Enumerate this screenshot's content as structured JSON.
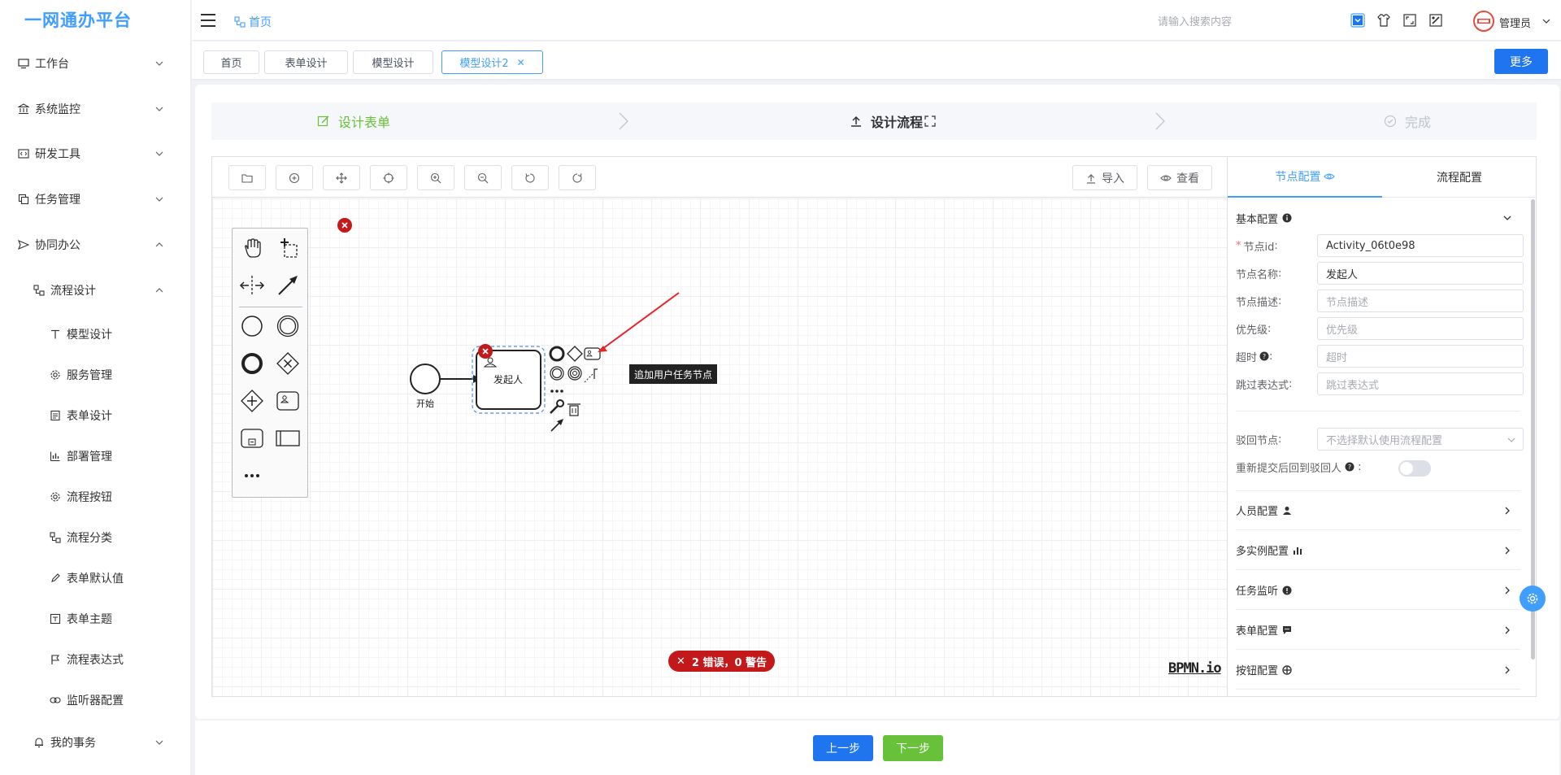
{
  "app": {
    "title": "一网通办平台"
  },
  "header": {
    "breadcrumb": "首页",
    "search_placeholder": "请输入搜索内容",
    "user": "管理员"
  },
  "sidebar": {
    "items": [
      {
        "label": "工作台",
        "level": 1,
        "expanded": false,
        "icon": "monitor-icon"
      },
      {
        "label": "系统监控",
        "level": 1,
        "expanded": false,
        "icon": "bank-icon"
      },
      {
        "label": "研发工具",
        "level": 1,
        "expanded": false,
        "icon": "code-window-icon"
      },
      {
        "label": "任务管理",
        "level": 1,
        "expanded": false,
        "icon": "copy-icon"
      },
      {
        "label": "协同办公",
        "level": 1,
        "expanded": true,
        "icon": "send-icon"
      },
      {
        "label": "流程设计",
        "level": 2,
        "expanded": true,
        "icon": "flow-icon"
      },
      {
        "label": "模型设计",
        "level": 3,
        "icon": "text-t-icon"
      },
      {
        "label": "服务管理",
        "level": 3,
        "icon": "gear-icon"
      },
      {
        "label": "表单设计",
        "level": 3,
        "icon": "form-icon"
      },
      {
        "label": "部署管理",
        "level": 3,
        "icon": "bar-chart-icon"
      },
      {
        "label": "流程按钮",
        "level": 3,
        "icon": "gear-icon"
      },
      {
        "label": "流程分类",
        "level": 3,
        "icon": "flow-icon"
      },
      {
        "label": "表单默认值",
        "level": 3,
        "icon": "edit-icon"
      },
      {
        "label": "表单主题",
        "level": 3,
        "icon": "theme-icon"
      },
      {
        "label": "流程表达式",
        "level": 3,
        "icon": "flag-icon"
      },
      {
        "label": "监听器配置",
        "level": 3,
        "icon": "link-icon"
      },
      {
        "label": "我的事务",
        "level": 2,
        "expanded": false,
        "icon": "bell-icon"
      }
    ]
  },
  "tags": [
    {
      "label": "首页",
      "active": false
    },
    {
      "label": "表单设计",
      "active": false
    },
    {
      "label": "模型设计",
      "active": false
    },
    {
      "label": "模型设计2",
      "active": true,
      "closable": true
    }
  ],
  "tags_more": "更多",
  "steps": [
    {
      "label": "设计表单",
      "status": "done"
    },
    {
      "label": "设计流程",
      "status": "active"
    },
    {
      "label": "完成",
      "status": "wait"
    }
  ],
  "toolbar": {
    "import_label": "导入",
    "view_label": "查看"
  },
  "diagram": {
    "start_label": "开始",
    "task_label": "发起人",
    "tooltip": "追加用户任务节点",
    "lint_status": "2 错误，0 警告",
    "logo": "BPMN.io"
  },
  "panel": {
    "tabs": [
      {
        "label": "节点配置",
        "active": true
      },
      {
        "label": "流程配置",
        "active": false
      }
    ],
    "basic_section": "基本配置",
    "fields": [
      {
        "label": "节点id",
        "required": true,
        "value": "Activity_06t0e98",
        "placeholder": ""
      },
      {
        "label": "节点名称",
        "required": false,
        "value": "发起人",
        "placeholder": ""
      },
      {
        "label": "节点描述",
        "required": false,
        "value": "",
        "placeholder": "节点描述"
      },
      {
        "label": "优先级",
        "required": false,
        "value": "",
        "placeholder": "优先级"
      },
      {
        "label": "超时",
        "required": false,
        "value": "",
        "placeholder": "超时",
        "help": true
      },
      {
        "label": "跳过表达式",
        "required": false,
        "value": "",
        "placeholder": "跳过表达式"
      }
    ],
    "reject_label": "驳回节点",
    "reject_placeholder": "不选择默认使用流程配置",
    "resubmit_label": "重新提交后回到驳回人",
    "resubmit_on": false,
    "sections": [
      {
        "label": "人员配置",
        "icon": "user-icon"
      },
      {
        "label": "多实例配置",
        "icon": "bar-chart-icon"
      },
      {
        "label": "任务监听",
        "icon": "info-icon"
      },
      {
        "label": "表单配置",
        "icon": "comment-icon"
      },
      {
        "label": "按钮配置",
        "icon": "move-icon"
      }
    ]
  },
  "footer": {
    "prev_label": "上一步",
    "next_label": "下一步"
  },
  "colors": {
    "primary": "#409eff",
    "button_blue": "#1f75f0",
    "success": "#67c23a",
    "error": "#c4191a"
  }
}
